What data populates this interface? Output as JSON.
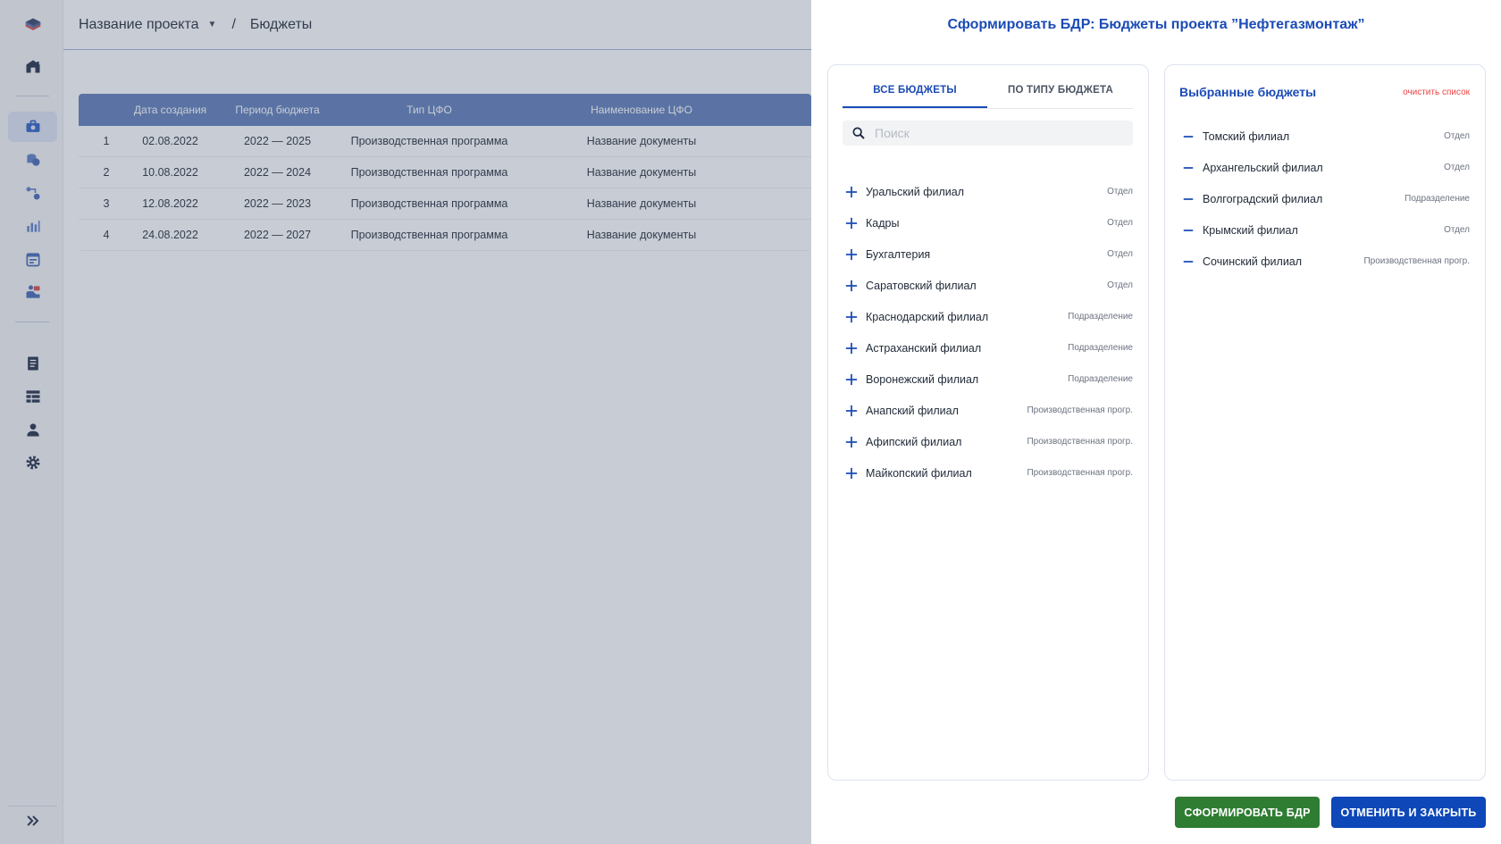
{
  "header": {
    "project": "Название проекта",
    "separator": "/",
    "page": "Бюджеты"
  },
  "table": {
    "columns": [
      "",
      "Дата создания",
      "Период бюджета",
      "Тип ЦФО",
      "Наименование ЦФО"
    ],
    "rows": [
      {
        "num": "1",
        "date": "02.08.2022",
        "period": "2022 — 2025",
        "type": "Производственная программа",
        "name": "Название документы"
      },
      {
        "num": "2",
        "date": "10.08.2022",
        "period": "2022 — 2024",
        "type": "Производственная программа",
        "name": "Название документы"
      },
      {
        "num": "3",
        "date": "12.08.2022",
        "period": "2022 — 2023",
        "type": "Производственная программа",
        "name": "Название документы"
      },
      {
        "num": "4",
        "date": "24.08.2022",
        "period": "2022 — 2027",
        "type": "Производственная программа",
        "name": "Название документы"
      }
    ]
  },
  "drawer": {
    "title": "Сформировать БДР:  Бюджеты проекта ”Нефтегазмонтаж”",
    "tabs": [
      "ВСЕ БЮДЖЕТЫ",
      "ПО ТИПУ БЮДЖЕТА"
    ],
    "search_placeholder": "Поиск",
    "available": [
      {
        "label": "Уральский филиал",
        "tag": "Отдел"
      },
      {
        "label": "Кадры",
        "tag": "Отдел"
      },
      {
        "label": "Бухгалтерия",
        "tag": "Отдел"
      },
      {
        "label": "Саратовский филиал",
        "tag": "Отдел"
      },
      {
        "label": "Краснодарский филиал",
        "tag": "Подразделение"
      },
      {
        "label": "Астраханский филиал",
        "tag": "Подразделение"
      },
      {
        "label": "Воронежский филиал",
        "tag": "Подразделение"
      },
      {
        "label": "Анапский филиал",
        "tag": "Производственная прогр."
      },
      {
        "label": "Афипский филиал",
        "tag": "Производственная прогр."
      },
      {
        "label": "Майкопский филиал",
        "tag": "Производственная прогр."
      }
    ],
    "selected_title": "Выбранные бюджеты",
    "clear_label": "очистить список",
    "selected": [
      {
        "label": "Томский филиал",
        "tag": "Отдел"
      },
      {
        "label": "Архангельский филиал",
        "tag": "Отдел"
      },
      {
        "label": "Волгоградский филиал",
        "tag": "Подразделение"
      },
      {
        "label": "Крымский филиал",
        "tag": "Отдел"
      },
      {
        "label": "Сочинский филиал",
        "tag": "Производственная прогр."
      }
    ],
    "submit_label": "СФОРМИРОВАТЬ БДР",
    "cancel_label": "ОТМЕНИТЬ И ЗАКРЫТЬ"
  },
  "colors": {
    "accent": "#1b4bb5",
    "table_header": "#5b7bb8",
    "submit": "#2e7d32",
    "cancel": "#0d47b8",
    "danger": "#ef4444"
  }
}
